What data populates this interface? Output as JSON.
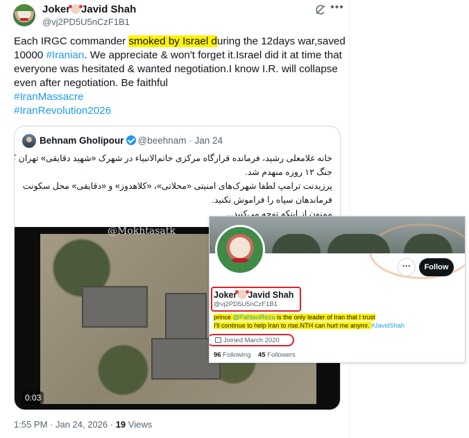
{
  "post": {
    "author_name": "Joker",
    "author_name_suffix": "Javid Shah",
    "author_handle": "@vj2PD5U5nCzF1B1",
    "text_lines": [
      {
        "pre": "Each IRGC commander ",
        "highlight": "smoked by Israel d",
        "post": "uring the 12days war,saved"
      },
      {
        "pre": "10000 ",
        "link": "#Iranian",
        "post": ". We appreciate & won't forget it.Israel did it at time that"
      },
      {
        "text": "everyone was hesitated & wanted negotiation.I know I.R. will collapse"
      },
      {
        "text": "even after negotiation. Be faithful"
      }
    ],
    "hashtags": [
      "#IranMassacre",
      "#IranRevolution2026"
    ],
    "timestamp": "1:55 PM · Jan 24, 2026 · ",
    "views_count": "19",
    "views_label": " Views"
  },
  "quote": {
    "author_name": "Behnam Gholipour",
    "author_handle": "@beehnam",
    "date": " · Jan 24",
    "text_lines": [
      "خانه غلامعلی رشید، فرمانده قرارگاه مرکزی خاتم‌الانبیاء در شهرک «شهید دقایقی» تهران که در",
      "جنگ ۱۲ روزه منهدم شد.",
      "پرزیدنت ترامپ لطفا شهرک‌های امنیتی «محلاتی»، «کلاهدوز» و «دقایقی» محل سکونت",
      "فرماندهان سپاه را فراموش نکنید.",
      "ممنون از اینکه توجه می‌کنید..."
    ],
    "video": {
      "watermark": "@Mokhtasatk",
      "duration": "0:03"
    }
  },
  "profile_card": {
    "name": "Joker",
    "name_suffix": "Javid Shah",
    "handle": "@vj2PD5U5nCzF1B1",
    "bio_line1_pre": "prince ",
    "bio_mention": "@PahlaviReza",
    "bio_line1_post": " is the only leader of Iran that I trust",
    "bio_line2": "I'll continue to help Iran to rise.NTH can hurt me anymr. ",
    "bio_hashtag": "#JavidShah",
    "joined": "Joined March 2020",
    "following_count": "96",
    "following_label": " Following",
    "followers_count": "45",
    "followers_label": " Followers",
    "follow_button": "Follow",
    "more_button": "···"
  },
  "icons": {
    "grok": "grok-icon",
    "more": "more-horizontal-icon",
    "verified": "verified-badge-icon",
    "calendar": "calendar-icon",
    "chevron": "chevron-right-icon"
  },
  "colors": {
    "link": "#1d9bf0",
    "highlight": "#fff200",
    "annotation_box": "#e0202a",
    "follow_button_bg": "#0f1419"
  }
}
